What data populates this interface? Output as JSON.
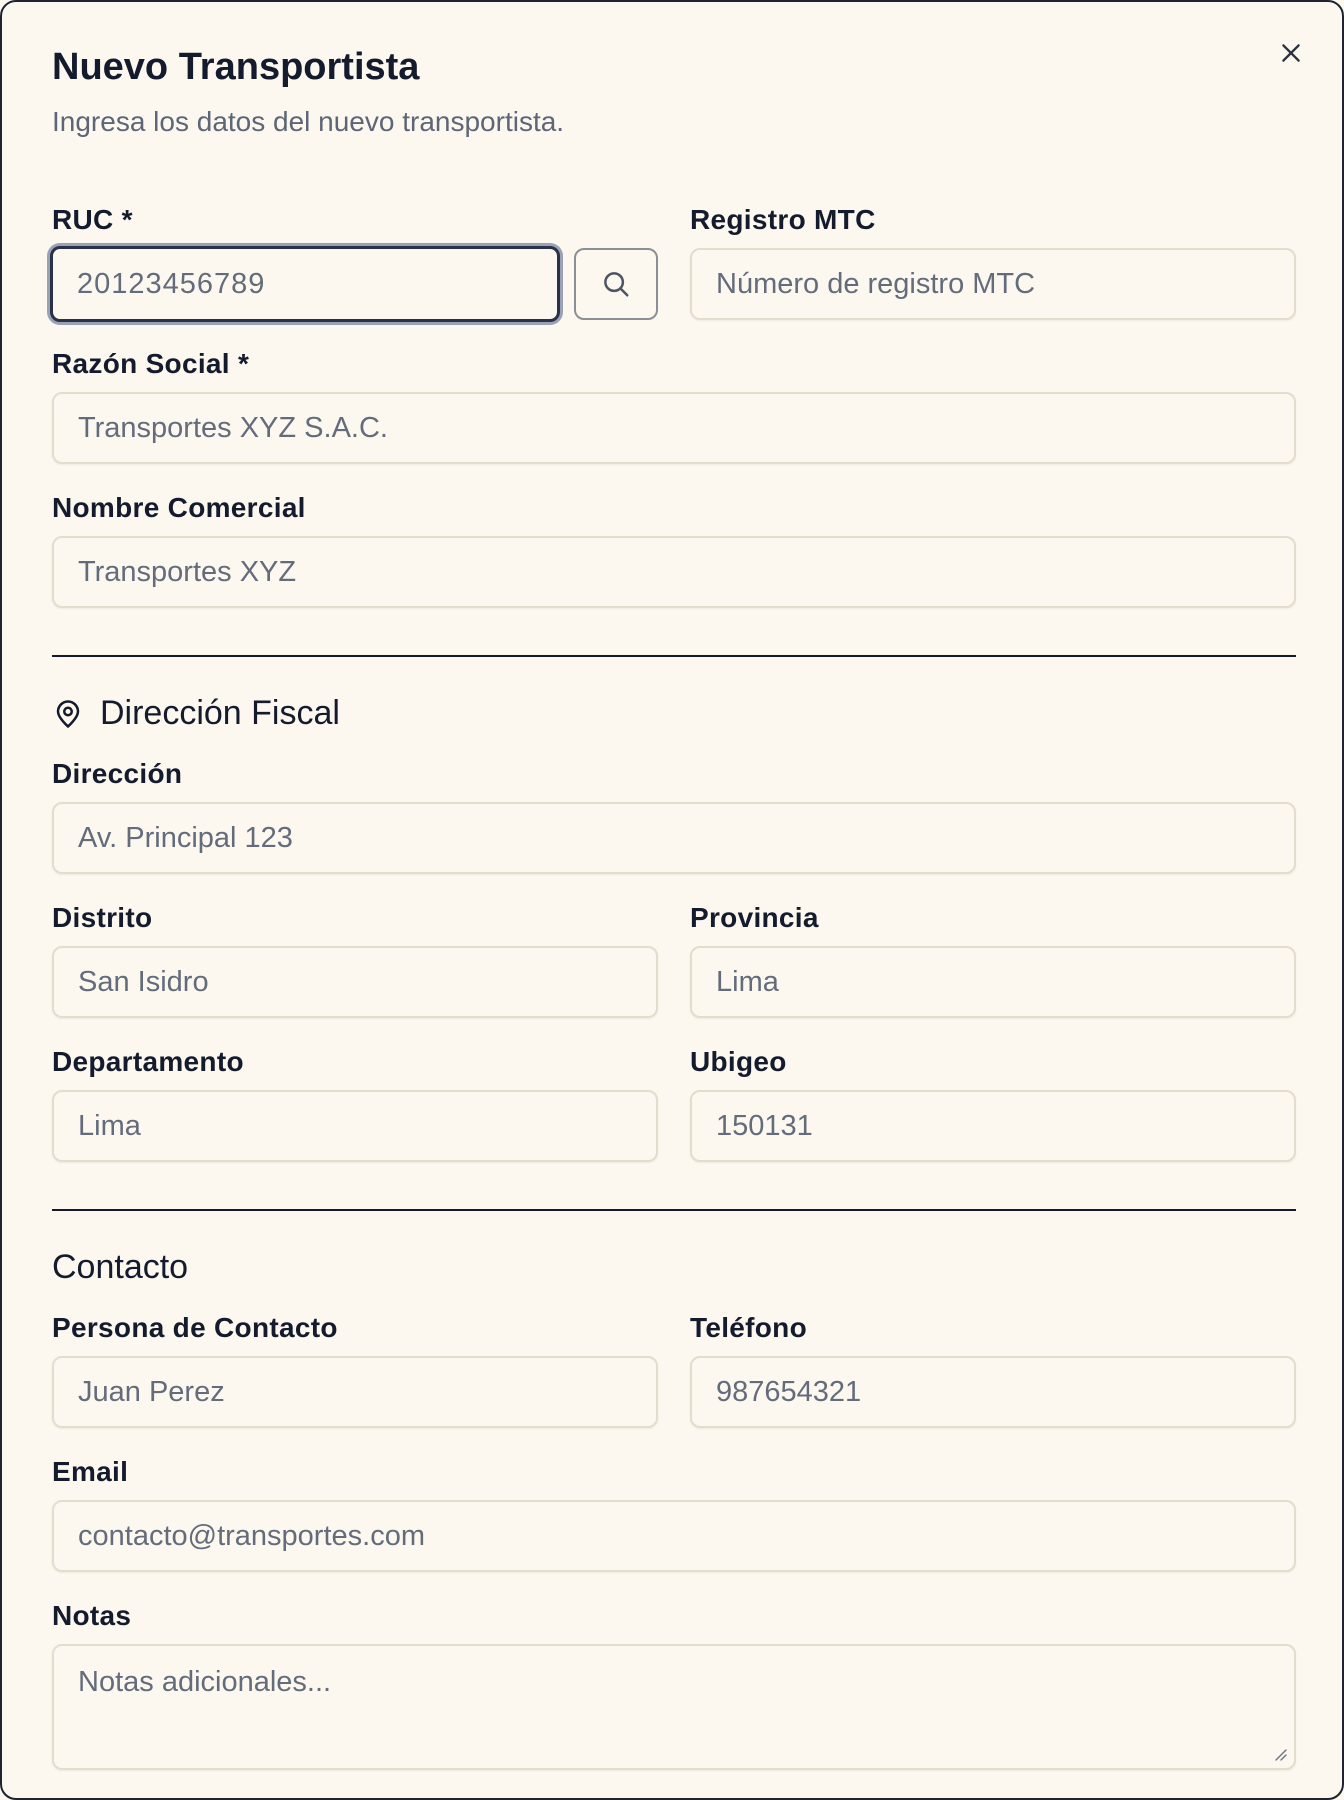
{
  "dialog": {
    "title": "Nuevo Transportista",
    "subtitle": "Ingresa los datos del nuevo transportista.",
    "close_icon": "close-icon"
  },
  "fields": {
    "ruc": {
      "label": "RUC *",
      "value": "20123456789"
    },
    "registro_mtc": {
      "label": "Registro MTC",
      "placeholder": "Número de registro MTC"
    },
    "razon_social": {
      "label": "Razón Social *",
      "placeholder": "Transportes XYZ S.A.C."
    },
    "nombre_comercial": {
      "label": "Nombre Comercial",
      "placeholder": "Transportes XYZ"
    }
  },
  "search_button": {
    "icon": "search-icon"
  },
  "direccion_fiscal": {
    "title": "Dirección Fiscal",
    "icon": "map-pin-icon",
    "direccion": {
      "label": "Dirección",
      "placeholder": "Av. Principal 123"
    },
    "distrito": {
      "label": "Distrito",
      "placeholder": "San Isidro"
    },
    "provincia": {
      "label": "Provincia",
      "placeholder": "Lima"
    },
    "departamento": {
      "label": "Departamento",
      "placeholder": "Lima"
    },
    "ubigeo": {
      "label": "Ubigeo",
      "placeholder": "150131"
    }
  },
  "contacto": {
    "title": "Contacto",
    "persona": {
      "label": "Persona de Contacto",
      "placeholder": "Juan Perez"
    },
    "telefono": {
      "label": "Teléfono",
      "placeholder": "987654321"
    },
    "email": {
      "label": "Email",
      "placeholder": "contacto@transportes.com"
    },
    "notas": {
      "label": "Notas",
      "placeholder": "Notas adicionales..."
    }
  },
  "colors": {
    "background": "#fcf8ef",
    "text": "#141b2d",
    "muted": "#5d6576",
    "border": "#e4dccd",
    "focus_ring": "#2a3247"
  }
}
